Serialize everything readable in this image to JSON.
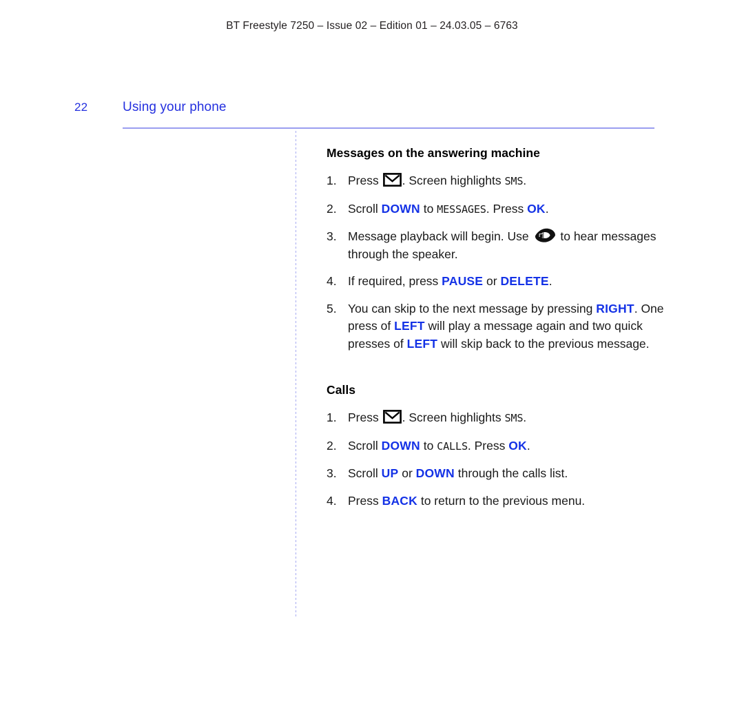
{
  "page": {
    "running_header": "BT Freestyle 7250 – Issue 02 – Edition 01 – 24.03.05 – 6763",
    "folio": "22",
    "chapter_title": "Using your phone",
    "accent_color": "#2430df",
    "key_color": "#1432e6",
    "rule_color": "#9a9ef0",
    "text_color": "#1a1a1a"
  },
  "sections": [
    {
      "heading": "Messages on the answering machine",
      "steps": [
        {
          "num": "1.",
          "parts": [
            {
              "type": "text",
              "value": "Press "
            },
            {
              "type": "icon",
              "value": "envelope-icon"
            },
            {
              "type": "text",
              "value": ". Screen highlights "
            },
            {
              "type": "lcd",
              "value": "SMS"
            },
            {
              "type": "text",
              "value": "."
            }
          ]
        },
        {
          "num": "2.",
          "parts": [
            {
              "type": "text",
              "value": "Scroll "
            },
            {
              "type": "key",
              "value": "DOWN"
            },
            {
              "type": "text",
              "value": " to "
            },
            {
              "type": "lcd",
              "value": "MESSAGES"
            },
            {
              "type": "text",
              "value": ". Press "
            },
            {
              "type": "key",
              "value": "OK"
            },
            {
              "type": "text",
              "value": "."
            }
          ]
        },
        {
          "num": "3.",
          "parts": [
            {
              "type": "text",
              "value": "Message playback will begin. Use "
            },
            {
              "type": "icon",
              "value": "loudspeaker-icon"
            },
            {
              "type": "text",
              "value": " to hear messages through the speaker."
            }
          ]
        },
        {
          "num": "4.",
          "parts": [
            {
              "type": "text",
              "value": "If required, press "
            },
            {
              "type": "key",
              "value": "PAUSE"
            },
            {
              "type": "text",
              "value": " or "
            },
            {
              "type": "key",
              "value": "DELETE"
            },
            {
              "type": "text",
              "value": "."
            }
          ]
        },
        {
          "num": "5.",
          "parts": [
            {
              "type": "text",
              "value": "You can skip to the next message by pressing "
            },
            {
              "type": "key",
              "value": "RIGHT"
            },
            {
              "type": "text",
              "value": ". One press of "
            },
            {
              "type": "key",
              "value": "LEFT"
            },
            {
              "type": "text",
              "value": " will play a message again and two quick presses of "
            },
            {
              "type": "key",
              "value": "LEFT"
            },
            {
              "type": "text",
              "value": " will skip back to the previous message."
            }
          ]
        }
      ]
    },
    {
      "heading": "Calls",
      "steps": [
        {
          "num": "1.",
          "parts": [
            {
              "type": "text",
              "value": "Press "
            },
            {
              "type": "icon",
              "value": "envelope-icon"
            },
            {
              "type": "text",
              "value": ". Screen highlights "
            },
            {
              "type": "lcd",
              "value": "SMS"
            },
            {
              "type": "text",
              "value": "."
            }
          ]
        },
        {
          "num": "2.",
          "parts": [
            {
              "type": "text",
              "value": "Scroll "
            },
            {
              "type": "key",
              "value": "DOWN"
            },
            {
              "type": "text",
              "value": " to "
            },
            {
              "type": "lcd",
              "value": "CALLS"
            },
            {
              "type": "text",
              "value": ". Press "
            },
            {
              "type": "key",
              "value": "OK"
            },
            {
              "type": "text",
              "value": "."
            }
          ]
        },
        {
          "num": "3.",
          "parts": [
            {
              "type": "text",
              "value": "Scroll "
            },
            {
              "type": "key",
              "value": "UP"
            },
            {
              "type": "text",
              "value": " or "
            },
            {
              "type": "key",
              "value": "DOWN"
            },
            {
              "type": "text",
              "value": " through the calls list."
            }
          ]
        },
        {
          "num": "4.",
          "parts": [
            {
              "type": "text",
              "value": "Press "
            },
            {
              "type": "key",
              "value": "BACK"
            },
            {
              "type": "text",
              "value": " to return to the previous menu."
            }
          ]
        }
      ]
    }
  ]
}
